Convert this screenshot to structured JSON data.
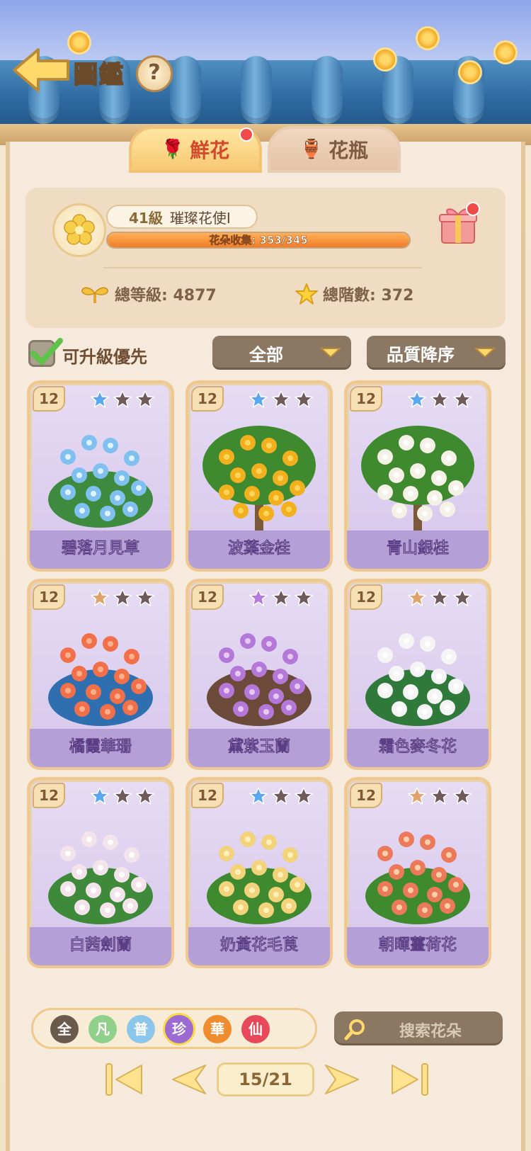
{
  "header": {
    "title": "圖鑑",
    "help_label": "?"
  },
  "tabs": [
    {
      "label": "鮮花",
      "active": true,
      "has_notification": true
    },
    {
      "label": "花瓶",
      "active": false,
      "has_notification": false
    }
  ],
  "profile": {
    "level_label": "41級",
    "rank_title": "璀璨花使I",
    "collection_text": "花朵收集: 353/345",
    "collection_progress": 1.0,
    "total_level_label": "總等級: 4877",
    "total_stage_label": "總階數: 372"
  },
  "filters": {
    "upgrade_priority_label": "可升級優先",
    "upgrade_priority_checked": true,
    "category_label": "全部",
    "sort_label": "品質降序"
  },
  "cards": [
    {
      "level": "12",
      "name": "碧落月見草",
      "stars_filled": 1,
      "star_color": "#5aa9f0",
      "plant": "blue-flower-bush"
    },
    {
      "level": "12",
      "name": "波葉金桂",
      "stars_filled": 1,
      "star_color": "#5aa9f0",
      "plant": "golden-osmanthus-tree"
    },
    {
      "level": "12",
      "name": "青山銀桂",
      "stars_filled": 1,
      "star_color": "#5aa9f0",
      "plant": "silver-osmanthus-tree"
    },
    {
      "level": "12",
      "name": "橘霞華珊",
      "stars_filled": 0,
      "star_color": "#e0a36a",
      "plant": "coral-plant"
    },
    {
      "level": "12",
      "name": "黛紫玉蘭",
      "stars_filled": 1,
      "star_color": "#b77be0",
      "plant": "purple-magnolia"
    },
    {
      "level": "12",
      "name": "霜色麥冬花",
      "stars_filled": 0,
      "star_color": "#e0a36a",
      "plant": "white-lilyturf"
    },
    {
      "level": "12",
      "name": "白茜劍蘭",
      "stars_filled": 1,
      "star_color": "#5aa9f0",
      "plant": "white-gladiolus"
    },
    {
      "level": "12",
      "name": "奶黃花毛茛",
      "stars_filled": 1,
      "star_color": "#5aa9f0",
      "plant": "yellow-ranunculus"
    },
    {
      "level": "12",
      "name": "朝暉薑荷花",
      "stars_filled": 0,
      "star_color": "#e0a36a",
      "plant": "red-curcuma"
    }
  ],
  "rarity_filters": [
    {
      "label": "全",
      "color": "#6b5a4b"
    },
    {
      "label": "凡",
      "color": "#8fd18a"
    },
    {
      "label": "普",
      "color": "#8cc6ea"
    },
    {
      "label": "珍",
      "color": "#9b6ad3"
    },
    {
      "label": "華",
      "color": "#ef8c2e"
    },
    {
      "label": "仙",
      "color": "#e8485a"
    }
  ],
  "search": {
    "placeholder": "搜索花朵"
  },
  "pagination": {
    "current_label": "15/21"
  }
}
